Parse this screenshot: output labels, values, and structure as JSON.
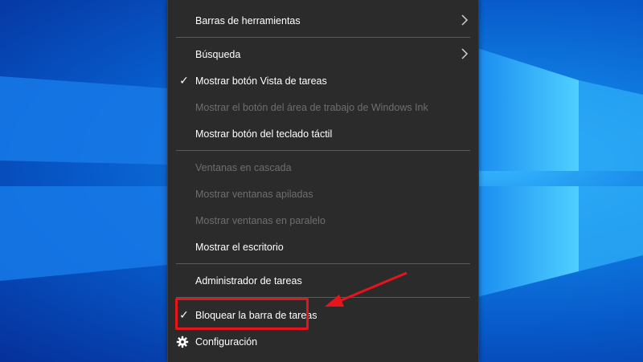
{
  "menu": {
    "items": [
      {
        "label": "Barras de herramientas",
        "submenu": true,
        "checked": false,
        "enabled": true
      },
      {
        "label": "Búsqueda",
        "submenu": true,
        "checked": false,
        "enabled": true
      },
      {
        "label": "Mostrar botón Vista de tareas",
        "submenu": false,
        "checked": true,
        "enabled": true
      },
      {
        "label": "Mostrar el botón del área de trabajo de Windows Ink",
        "submenu": false,
        "checked": false,
        "enabled": false
      },
      {
        "label": "Mostrar botón del teclado táctil",
        "submenu": false,
        "checked": false,
        "enabled": true
      },
      {
        "label": "Ventanas en cascada",
        "submenu": false,
        "checked": false,
        "enabled": false
      },
      {
        "label": "Mostrar ventanas apiladas",
        "submenu": false,
        "checked": false,
        "enabled": false
      },
      {
        "label": "Mostrar ventanas en paralelo",
        "submenu": false,
        "checked": false,
        "enabled": false
      },
      {
        "label": "Mostrar el escritorio",
        "submenu": false,
        "checked": false,
        "enabled": true
      },
      {
        "label": "Administrador de tareas",
        "submenu": false,
        "checked": false,
        "enabled": true
      },
      {
        "label": "Bloquear la barra de tareas",
        "submenu": false,
        "checked": true,
        "enabled": true
      },
      {
        "label": "Configuración",
        "submenu": false,
        "checked": false,
        "enabled": true,
        "icon": "gear-icon"
      }
    ],
    "check_glyph": "✓"
  },
  "annotation": {
    "highlight_color": "#e8141b",
    "highlighted_item": "Bloquear la barra de tareas"
  },
  "colors": {
    "menu_bg": "#2b2b2b",
    "text": "#ffffff",
    "disabled_text": "#6e6e6e",
    "separator": "#5a5a5a"
  }
}
